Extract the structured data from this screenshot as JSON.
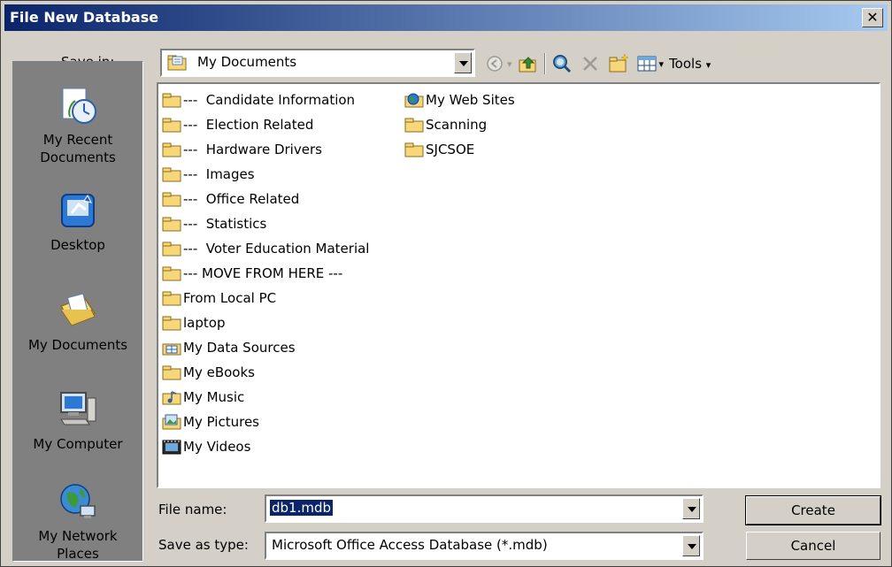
{
  "dialog": {
    "title": "File New Database",
    "close_glyph": "✕"
  },
  "save_in": {
    "label": "Save in:",
    "value": "My Documents",
    "icon": "my-documents-icon"
  },
  "toolbar": {
    "tools_label": "Tools",
    "tools_arrow": "▾",
    "view_arrow": "▾",
    "back_arrow": "▾"
  },
  "places": [
    {
      "label_line1": "My Recent",
      "label_line2": "Documents",
      "icon": "recent-documents-icon"
    },
    {
      "label_line1": "Desktop",
      "label_line2": "",
      "icon": "desktop-icon"
    },
    {
      "label_line1": "My Documents",
      "label_line2": "",
      "icon": "my-documents-icon"
    },
    {
      "label_line1": "My Computer",
      "label_line2": "",
      "icon": "my-computer-icon"
    },
    {
      "label_line1": "My Network",
      "label_line2": "Places",
      "icon": "network-places-icon"
    }
  ],
  "files_col1": [
    {
      "name": "---  Candidate Information",
      "icon": "folder-icon"
    },
    {
      "name": "---  Election Related",
      "icon": "folder-icon"
    },
    {
      "name": "---  Hardware Drivers",
      "icon": "folder-icon"
    },
    {
      "name": "---  Images",
      "icon": "folder-icon"
    },
    {
      "name": "---  Office Related",
      "icon": "folder-icon"
    },
    {
      "name": "---  Statistics",
      "icon": "folder-icon"
    },
    {
      "name": "---  Voter Education Material",
      "icon": "folder-icon"
    },
    {
      "name": "--- MOVE FROM HERE ---",
      "icon": "folder-icon"
    },
    {
      "name": "From Local PC",
      "icon": "folder-icon"
    },
    {
      "name": "laptop",
      "icon": "folder-icon"
    },
    {
      "name": "My Data Sources",
      "icon": "data-sources-icon"
    },
    {
      "name": "My eBooks",
      "icon": "folder-icon"
    },
    {
      "name": "My Music",
      "icon": "music-folder-icon"
    },
    {
      "name": "My Pictures",
      "icon": "pictures-folder-icon"
    },
    {
      "name": "My Videos",
      "icon": "videos-folder-icon"
    }
  ],
  "files_col2": [
    {
      "name": "My Web Sites",
      "icon": "web-sites-icon"
    },
    {
      "name": "Scanning",
      "icon": "folder-icon"
    },
    {
      "name": "SJCSOE",
      "icon": "folder-icon"
    }
  ],
  "filename": {
    "label": "File name:",
    "value": "db1.mdb"
  },
  "savetype": {
    "label": "Save as type:",
    "value": "Microsoft Office Access Database (*.mdb)"
  },
  "buttons": {
    "create": "Create",
    "cancel": "Cancel"
  }
}
